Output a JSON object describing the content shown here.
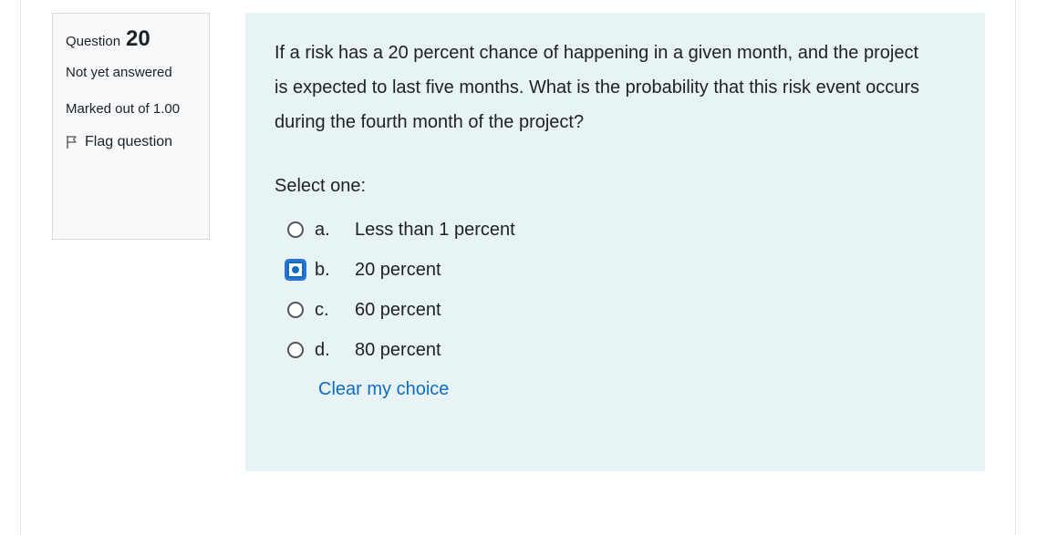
{
  "question_info": {
    "question_label": "Question",
    "question_number": "20",
    "state": "Not yet answered",
    "grade": "Marked out of 1.00",
    "flag_label": "Flag question"
  },
  "question": {
    "text": "If a risk has a 20 percent chance of happening in a given month, and the project is expected to last five months. What is the probability that this risk event occurs during the fourth month of the project?",
    "prompt": "Select one:",
    "answers": [
      {
        "letter": "a.",
        "text": "Less than 1 percent",
        "selected": false
      },
      {
        "letter": "b.",
        "text": "20 percent",
        "selected": true
      },
      {
        "letter": "c.",
        "text": "60 percent",
        "selected": false
      },
      {
        "letter": "d.",
        "text": "80 percent",
        "selected": false
      }
    ],
    "clear_label": "Clear my choice"
  },
  "colors": {
    "content_background": "#e7f3f5",
    "link": "#0f6cbf",
    "selected_radio": "#2b73d6"
  }
}
